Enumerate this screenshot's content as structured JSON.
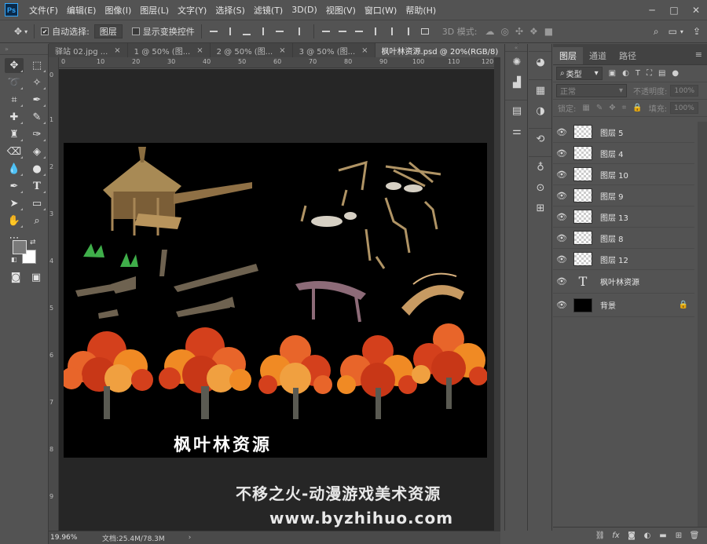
{
  "app": {
    "logo_text": "Ps"
  },
  "menu": [
    "文件(F)",
    "编辑(E)",
    "图像(I)",
    "图层(L)",
    "文字(Y)",
    "选择(S)",
    "滤镜(T)",
    "3D(D)",
    "视图(V)",
    "窗口(W)",
    "帮助(H)"
  ],
  "window_controls": {
    "minimize": "─",
    "maximize": "□",
    "close": "✕"
  },
  "options_bar": {
    "auto_select_label": "自动选择:",
    "auto_select_value": "图层",
    "show_transform_label": "显示变换控件",
    "mode_3d_label": "3D 模式:"
  },
  "doc_tabs": [
    {
      "label": "驿站 02.jpg ...",
      "active": false
    },
    {
      "label": "1 @ 50% (图...",
      "active": false
    },
    {
      "label": "2 @ 50% (图...",
      "active": false
    },
    {
      "label": "3 @ 50% (图...",
      "active": false
    },
    {
      "label": "枫叶林资源.psd @ 20%(RGB/8)",
      "active": true
    }
  ],
  "tab_close": "×",
  "ruler_top": [
    "0",
    "10",
    "20",
    "30",
    "40",
    "50",
    "60",
    "70",
    "80",
    "90",
    "100",
    "110",
    "120"
  ],
  "ruler_left": [
    "0",
    "1",
    "2",
    "3",
    "4",
    "5",
    "6",
    "7",
    "8",
    "9"
  ],
  "canvas": {
    "title_text": "枫叶林资源",
    "watermark_line1": "不移之火-动漫游戏美术资源",
    "watermark_line2": "www.byzhihuo.com"
  },
  "status": {
    "zoom": "19.96%",
    "doc_size": "文档:25.4M/78.3M",
    "arrow": "›"
  },
  "layers_panel": {
    "tabs": [
      "图层",
      "通道",
      "路径"
    ],
    "filter_label": "类型",
    "blend_mode": "正常",
    "opacity_label": "不透明度:",
    "opacity_value": "100%",
    "lock_label": "锁定:",
    "fill_label": "填充:",
    "fill_value": "100%",
    "layers": [
      {
        "name": "图层 5",
        "type": "pixel"
      },
      {
        "name": "图层 4",
        "type": "pixel"
      },
      {
        "name": "图层 10",
        "type": "pixel"
      },
      {
        "name": "图层 9",
        "type": "pixel"
      },
      {
        "name": "图层 13",
        "type": "pixel"
      },
      {
        "name": "图层 8",
        "type": "pixel"
      },
      {
        "name": "图层 12",
        "type": "pixel"
      },
      {
        "name": "枫叶林资源",
        "type": "text"
      },
      {
        "name": "背景",
        "type": "background"
      }
    ]
  },
  "colors": {
    "ui_bg": "#535353",
    "canvas_bg": "#262626",
    "artboard": "#000000",
    "accent": "#31a8ff",
    "foliage_red": "#d4401c",
    "foliage_orange": "#f08a24",
    "wood": "#9a7a4e"
  }
}
